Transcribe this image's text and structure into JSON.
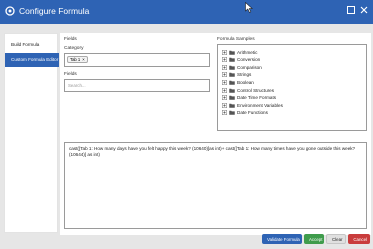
{
  "window": {
    "title": "Configure Formula"
  },
  "nav": {
    "items": [
      "Build Formula",
      "Custom Formula Editor"
    ]
  },
  "fields_panel": {
    "heading": "Fields",
    "category_label": "Category",
    "category_chip": "Tab 1",
    "category_chip_close": "×",
    "fields_label": "Fields",
    "fields_placeholder": "Search..."
  },
  "samples": {
    "heading": "Formula Samples",
    "items": [
      "Arithmetic",
      "Conversion",
      "Comparison",
      "Strings",
      "Boolean",
      "Control Structures",
      "Date Time Formats",
      "Environment Variables",
      "Date Functions"
    ]
  },
  "formula": {
    "text": "cast([Tab 1: How many days have you felt happy this week? (10640)]as int)+ cast([Tab 1: How many times have you gone outside this week? (10644)] as int)"
  },
  "buttons": {
    "validate": "Validate Formula",
    "accept": "Accept",
    "clear": "Clear",
    "cancel": "Cancel"
  },
  "colors": {
    "titlebar": "#2e63b4",
    "nav_active": "#2e63b4",
    "accept": "#3f9c4c",
    "cancel": "#c93c3c"
  }
}
